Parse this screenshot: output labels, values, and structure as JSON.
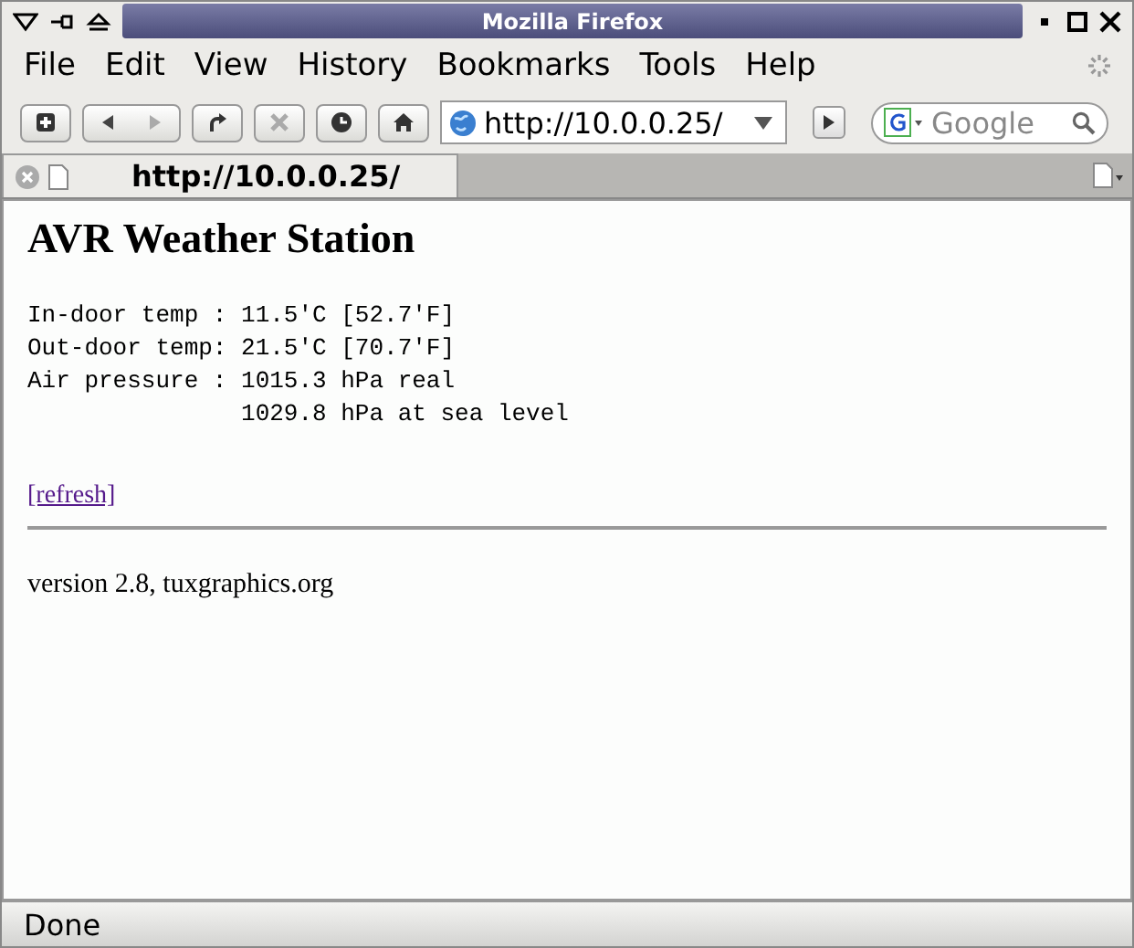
{
  "window": {
    "title": "Mozilla Firefox"
  },
  "menu": [
    "File",
    "Edit",
    "View",
    "History",
    "Bookmarks",
    "Tools",
    "Help"
  ],
  "toolbar": {
    "url": "http://10.0.0.25/",
    "search": {
      "placeholder": "Google"
    }
  },
  "tabs": [
    {
      "label": "http://10.0.0.25/",
      "selected": true
    }
  ],
  "page": {
    "heading": "AVR Weather Station",
    "readings": [
      "In-door temp : 11.5'C [52.7'F]",
      "Out-door temp: 21.5'C [70.7'F]",
      "Air pressure : 1015.3 hPa real",
      "               1029.8 hPa at sea level"
    ],
    "link": "[refresh]",
    "footer": "version 2.8, tuxgraphics.org"
  },
  "status_bar": "Done"
}
